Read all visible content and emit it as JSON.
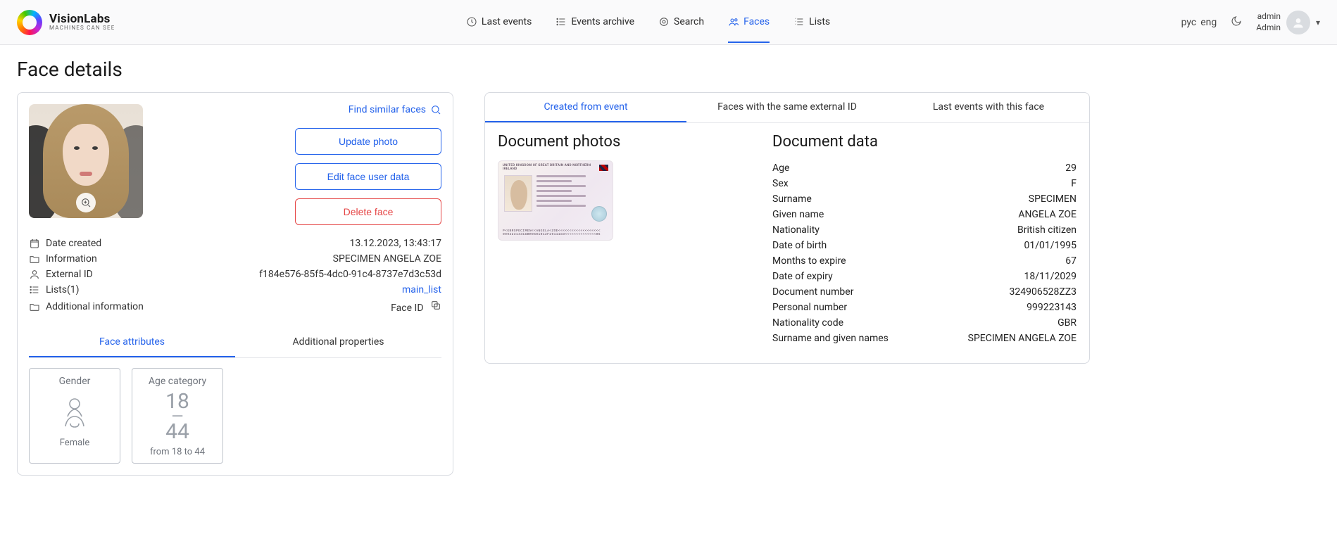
{
  "brand": {
    "title": "VisionLabs",
    "tagline": "MACHINES CAN SEE"
  },
  "nav": {
    "last_events": "Last events",
    "events_archive": "Events archive",
    "search": "Search",
    "faces": "Faces",
    "lists": "Lists"
  },
  "lang": {
    "rus": "рус",
    "eng": "eng"
  },
  "user": {
    "line1": "admin",
    "line2": "Admin"
  },
  "page_title": "Face details",
  "actions": {
    "find_similar": "Find similar faces",
    "update_photo": "Update photo",
    "edit_data": "Edit face user data",
    "delete_face": "Delete face"
  },
  "meta": {
    "date_created_label": "Date created",
    "date_created_value": "13.12.2023, 13:43:17",
    "information_label": "Information",
    "information_value": "SPECIMEN ANGELA ZOE",
    "external_id_label": "External ID",
    "external_id_value": "f184e576-85f5-4dc0-91c4-8737e7d3c53d",
    "lists_label": "Lists(1)",
    "lists_value": "main_list",
    "additional_label": "Additional information",
    "additional_value": "Face ID"
  },
  "subtabs": {
    "attributes": "Face attributes",
    "additional": "Additional properties"
  },
  "attributes": {
    "gender_title": "Gender",
    "gender_value": "Female",
    "age_title": "Age category",
    "age_lo": "18",
    "age_hi": "44",
    "age_sub": "from 18 to 44"
  },
  "right_tabs": {
    "created": "Created from event",
    "same_ext": "Faces with the same external ID",
    "last_events": "Last events with this face"
  },
  "doc_photos_title": "Document photos",
  "doc_data_title": "Document data",
  "passport": {
    "top": "UNITED KINGDOM OF GREAT BRITAIN AND NORTHERN IRELAND",
    "mrz1": "P<GBRSPECIMEN<<ANGELA<ZOE<<<<<<<<<<<<<<<<<<<",
    "mrz2": "9992231431GBR9501012F2911183<<<<<<<<<<<<<<06"
  },
  "doc_data": [
    {
      "k": "Age",
      "v": "29"
    },
    {
      "k": "Sex",
      "v": "F"
    },
    {
      "k": "Surname",
      "v": "SPECIMEN"
    },
    {
      "k": "Given name",
      "v": "ANGELA ZOE"
    },
    {
      "k": "Nationality",
      "v": "British citizen"
    },
    {
      "k": "Date of birth",
      "v": "01/01/1995"
    },
    {
      "k": "Months to expire",
      "v": "67"
    },
    {
      "k": "Date of expiry",
      "v": "18/11/2029"
    },
    {
      "k": "Document number",
      "v": "324906528ZZ3"
    },
    {
      "k": "Personal number",
      "v": "999223143"
    },
    {
      "k": "Nationality code",
      "v": "GBR"
    },
    {
      "k": "Surname and given names",
      "v": "SPECIMEN ANGELA ZOE"
    }
  ]
}
